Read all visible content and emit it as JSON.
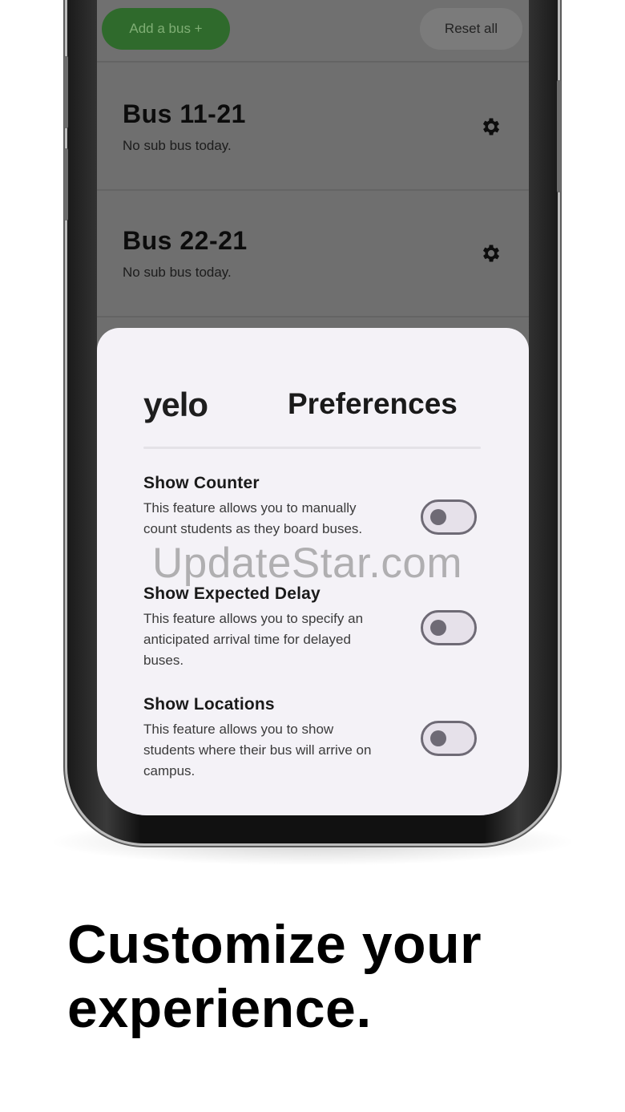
{
  "toolbar": {
    "add_bus_label": "Add a bus +",
    "reset_all_label": "Reset all"
  },
  "buses": [
    {
      "title": "Bus 11-21",
      "status": "No sub bus today."
    },
    {
      "title": "Bus 22-21",
      "status": "No sub bus today."
    }
  ],
  "preferences": {
    "logo_text": "yelo",
    "title": "Preferences",
    "items": [
      {
        "title": "Show Counter",
        "description": "This feature allows you to manually count students as they board buses.",
        "enabled": false
      },
      {
        "title": "Show Expected Delay",
        "description": "This feature allows you to specify an anticipated arrival time for delayed buses.",
        "enabled": false
      },
      {
        "title": "Show Locations",
        "description": "This feature allows you to show students where their bus will arrive on campus.",
        "enabled": false
      }
    ]
  },
  "watermark": "UpdateStar.com",
  "headline": {
    "line1": "Customize your",
    "line2": "experience."
  },
  "colors": {
    "add_button": "#2f6a2c",
    "sheet_background": "#f4f2f7",
    "toggle_off": "#6e6a75"
  }
}
